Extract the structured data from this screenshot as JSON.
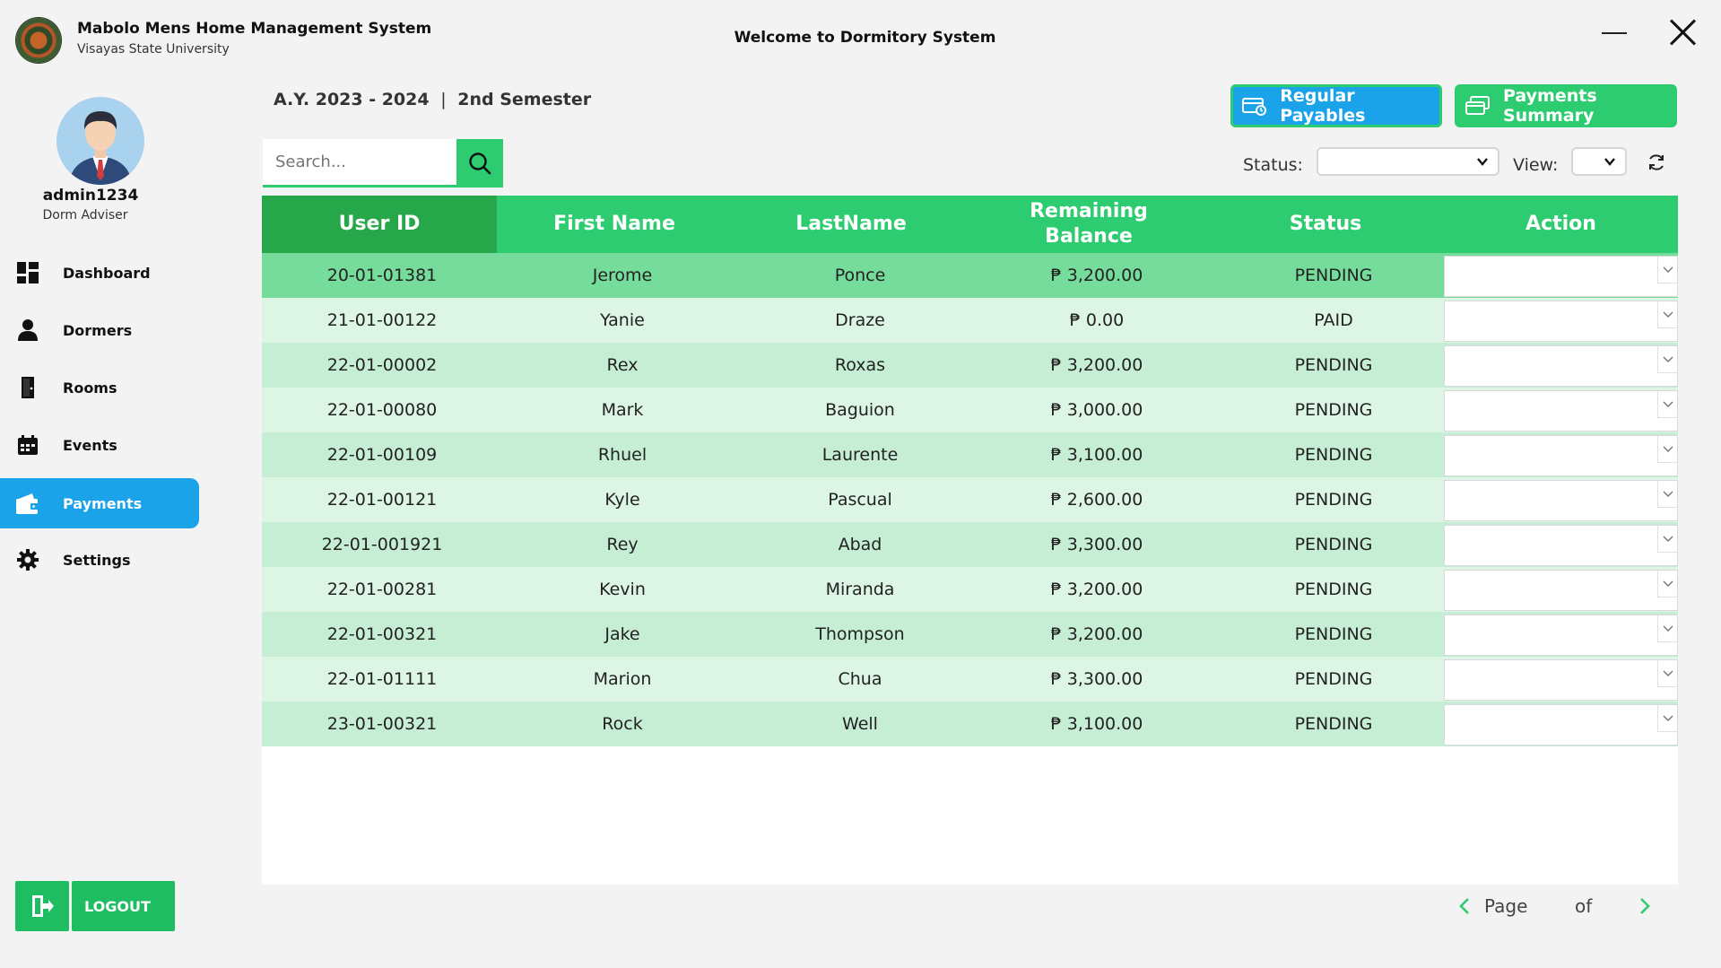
{
  "app": {
    "title": "Mabolo Mens Home Management System",
    "subtitle": "Visayas State University",
    "welcome": "Welcome to Dormitory System"
  },
  "user": {
    "name": "admin1234",
    "role": "Dorm Adviser"
  },
  "sidebar": {
    "items": [
      {
        "label": "Dashboard",
        "icon": "dashboard-icon"
      },
      {
        "label": "Dormers",
        "icon": "person-icon"
      },
      {
        "label": "Rooms",
        "icon": "door-icon"
      },
      {
        "label": "Events",
        "icon": "calendar-icon"
      },
      {
        "label": "Payments",
        "icon": "wallet-icon",
        "active": true
      },
      {
        "label": "Settings",
        "icon": "gear-icon"
      }
    ],
    "logout_label": "LOGOUT"
  },
  "header": {
    "academic_year": "A.Y. 2023 - 2024",
    "separator": "|",
    "semester": "2nd Semester",
    "search_placeholder": "Search...",
    "regular_payables_label": "Regular Payables",
    "payments_summary_label": "Payments Summary",
    "status_label": "Status:",
    "status_value": "",
    "view_label": "View:",
    "view_value": ""
  },
  "colors": {
    "accent_green": "#2ecc71",
    "header_dark_green": "#26a74a",
    "accent_blue": "#1ba3ea",
    "row_selected": "#76dc9b"
  },
  "table": {
    "columns": [
      "User ID",
      "First Name",
      "LastName",
      "Remaining\nBalance",
      "Status",
      "Action"
    ],
    "rows": [
      {
        "user_id": "20-01-01381",
        "first": "Jerome",
        "last": "Ponce",
        "balance": "₱ 3,200.00",
        "status": "PENDING"
      },
      {
        "user_id": "21-01-00122",
        "first": "Yanie",
        "last": "Draze",
        "balance": "₱ 0.00",
        "status": "PAID"
      },
      {
        "user_id": "22-01-00002",
        "first": "Rex",
        "last": "Roxas",
        "balance": "₱ 3,200.00",
        "status": "PENDING"
      },
      {
        "user_id": "22-01-00080",
        "first": "Mark",
        "last": "Baguion",
        "balance": "₱ 3,000.00",
        "status": "PENDING"
      },
      {
        "user_id": "22-01-00109",
        "first": "Rhuel",
        "last": "Laurente",
        "balance": "₱ 3,100.00",
        "status": "PENDING"
      },
      {
        "user_id": "22-01-00121",
        "first": "Kyle",
        "last": "Pascual",
        "balance": "₱ 2,600.00",
        "status": "PENDING"
      },
      {
        "user_id": "22-01-001921",
        "first": "Rey",
        "last": "Abad",
        "balance": "₱ 3,300.00",
        "status": "PENDING"
      },
      {
        "user_id": "22-01-00281",
        "first": "Kevin",
        "last": "Miranda",
        "balance": "₱ 3,200.00",
        "status": "PENDING"
      },
      {
        "user_id": "22-01-00321",
        "first": "Jake",
        "last": "Thompson",
        "balance": "₱ 3,200.00",
        "status": "PENDING"
      },
      {
        "user_id": "22-01-01111",
        "first": "Marion",
        "last": "Chua",
        "balance": "₱ 3,300.00",
        "status": "PENDING"
      },
      {
        "user_id": "23-01-00321",
        "first": "Rock",
        "last": "Well",
        "balance": "₱ 3,100.00",
        "status": "PENDING"
      }
    ]
  },
  "pagination": {
    "page_label": "Page",
    "of_label": "of"
  }
}
